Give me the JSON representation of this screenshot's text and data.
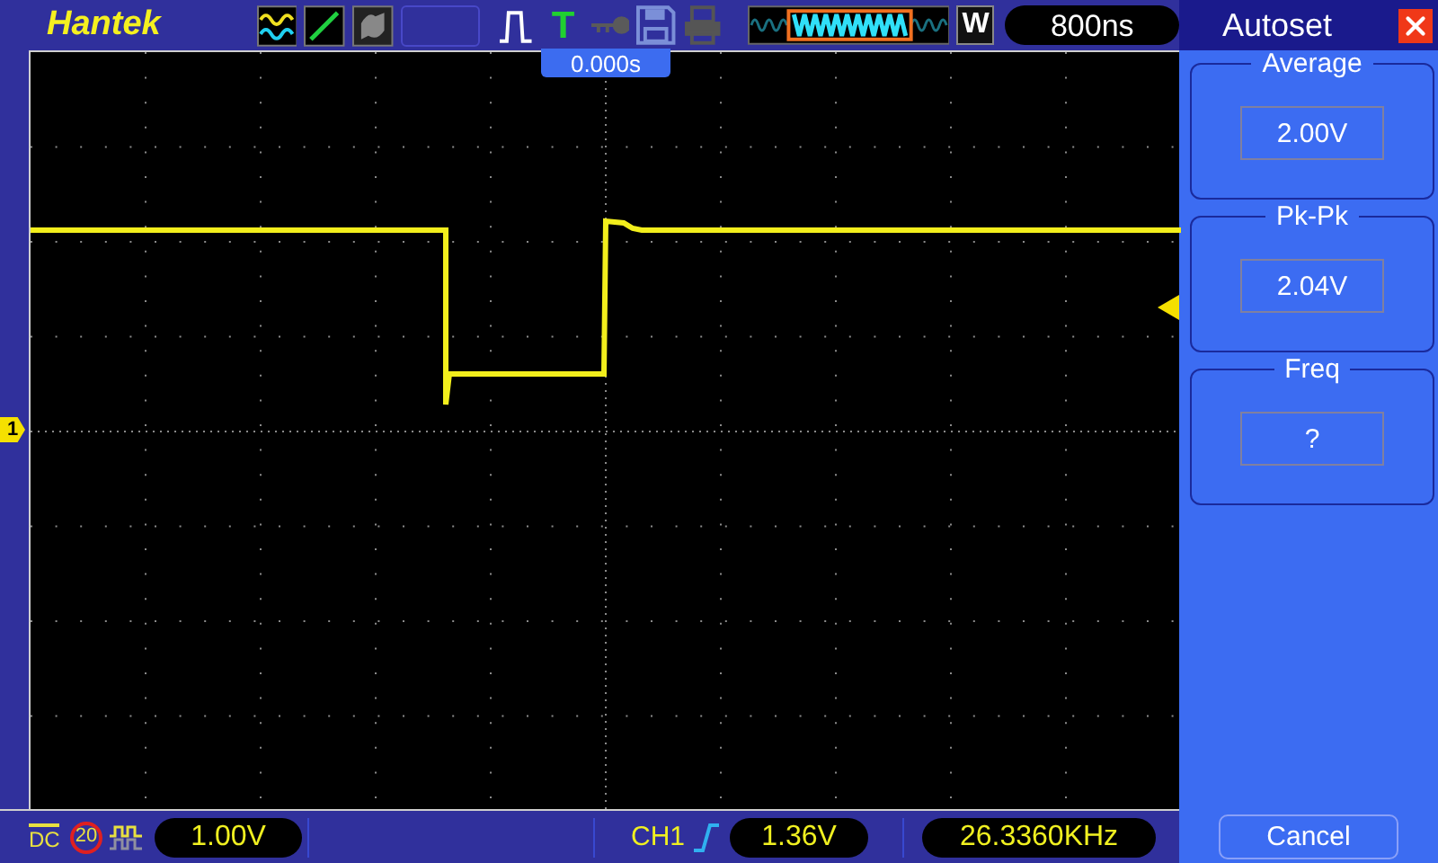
{
  "brand": "Hantek",
  "toolbar": {
    "trigger_label": "T",
    "window_key": "W",
    "timebase": "800ns"
  },
  "trigger_position": "0.000s",
  "channel_marker": "1",
  "status_bar": {
    "coupling": "DC",
    "bandwidth_limit": "20",
    "volts_per_div": "1.00V",
    "trigger_source": "CH1",
    "trigger_level": "1.36V",
    "frequency": "26.3360KHz"
  },
  "panel": {
    "title": "Autoset",
    "measurements": [
      {
        "label": "Average",
        "value": "2.00V"
      },
      {
        "label": "Pk-Pk",
        "value": "2.04V"
      },
      {
        "label": "Freq",
        "value": "?"
      }
    ],
    "cancel": "Cancel"
  }
}
